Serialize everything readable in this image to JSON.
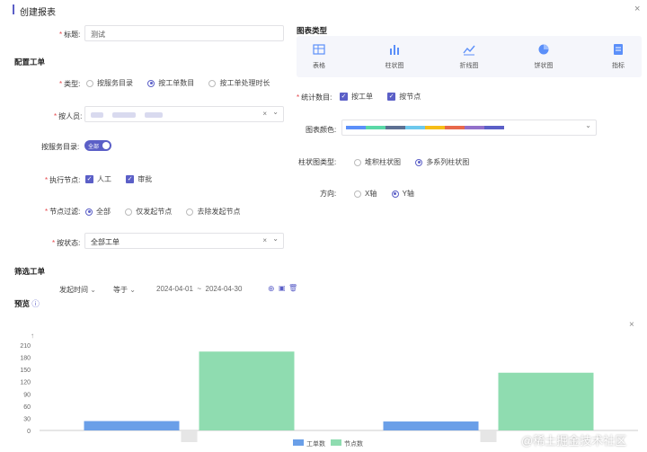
{
  "header": {
    "title": "创建报表",
    "close": "×"
  },
  "form": {
    "title_label": "标题:",
    "title_value": "测试",
    "config_section": "配置工单",
    "type_label": "类型:",
    "type_options": [
      "按服务目录",
      "按工单数目",
      "按工单处理时长"
    ],
    "person_label": "按人员:",
    "catalog_label": "按服务目录:",
    "catalog_toggle": "全部",
    "node_label": "执行节点:",
    "node_options": [
      "人工",
      "审批"
    ],
    "filter_label": "节点过滤:",
    "filter_options": [
      "全部",
      "仅发起节点",
      "去除发起节点"
    ],
    "status_label": "按状态:",
    "status_value": "全部工单",
    "clear": "×",
    "arrow": "⌄"
  },
  "filter": {
    "section": "筛选工单",
    "field": "发起时间",
    "op": "等于",
    "start": "2024-04-01",
    "sep": "~",
    "end": "2024-04-30"
  },
  "preview_label": "预览",
  "chart_types": {
    "title": "图表类型",
    "items": [
      "表格",
      "柱状图",
      "折线图",
      "饼状图",
      "指标"
    ]
  },
  "stats": {
    "label": "统计数目:",
    "options": [
      "按工单",
      "按节点"
    ]
  },
  "colors": {
    "label": "图表颜色:",
    "swatches": [
      "#5b8ff9",
      "#5ad8a6",
      "#5d7092",
      "#6dc8ec",
      "#f6bd16",
      "#e8684a",
      "#9270ca",
      "#5b5fc7"
    ],
    "accent": "#5b5fc7"
  },
  "bar_type": {
    "label": "柱状图类型:",
    "options": [
      "堆积柱状图",
      "多系列柱状图"
    ]
  },
  "direction": {
    "label": "方向:",
    "options": [
      "X轴",
      "Y轴"
    ]
  },
  "watermark": "@稀土掘金技术社区",
  "chart_data": {
    "type": "bar",
    "categories": [
      "",
      ""
    ],
    "series": [
      {
        "name": "工单数",
        "color": "#6a9fe8",
        "values": [
          23,
          22
        ]
      },
      {
        "name": "节点数",
        "color": "#8fdcb0",
        "values": [
          194,
          142
        ]
      }
    ],
    "ylim": [
      0,
      210
    ],
    "yticks": [
      0,
      30,
      60,
      90,
      120,
      150,
      180,
      210
    ],
    "grid": false,
    "legend": "bottom"
  }
}
